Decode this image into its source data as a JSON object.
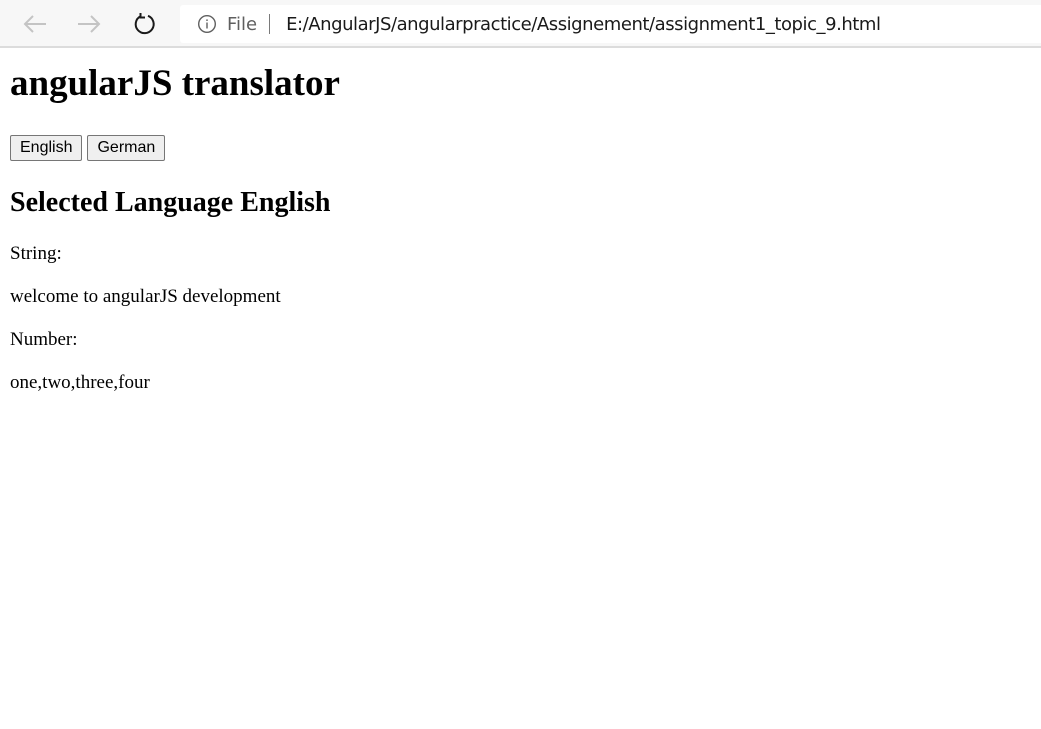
{
  "browser": {
    "scheme_label": "File",
    "url": "E:/AngularJS/angularpractice/Assignement/assignment1_topic_9.html",
    "icons": {
      "back": "arrow-left-icon",
      "forward": "arrow-right-icon",
      "reload": "reload-icon",
      "info": "info-icon"
    }
  },
  "page": {
    "title": "angularJS translator",
    "buttons": [
      {
        "label": "English"
      },
      {
        "label": "German"
      }
    ],
    "selected_heading": "Selected Language English",
    "string_label": "String:",
    "string_value": "welcome to angularJS development",
    "number_label": "Number:",
    "number_value": "one,two,three,four"
  }
}
